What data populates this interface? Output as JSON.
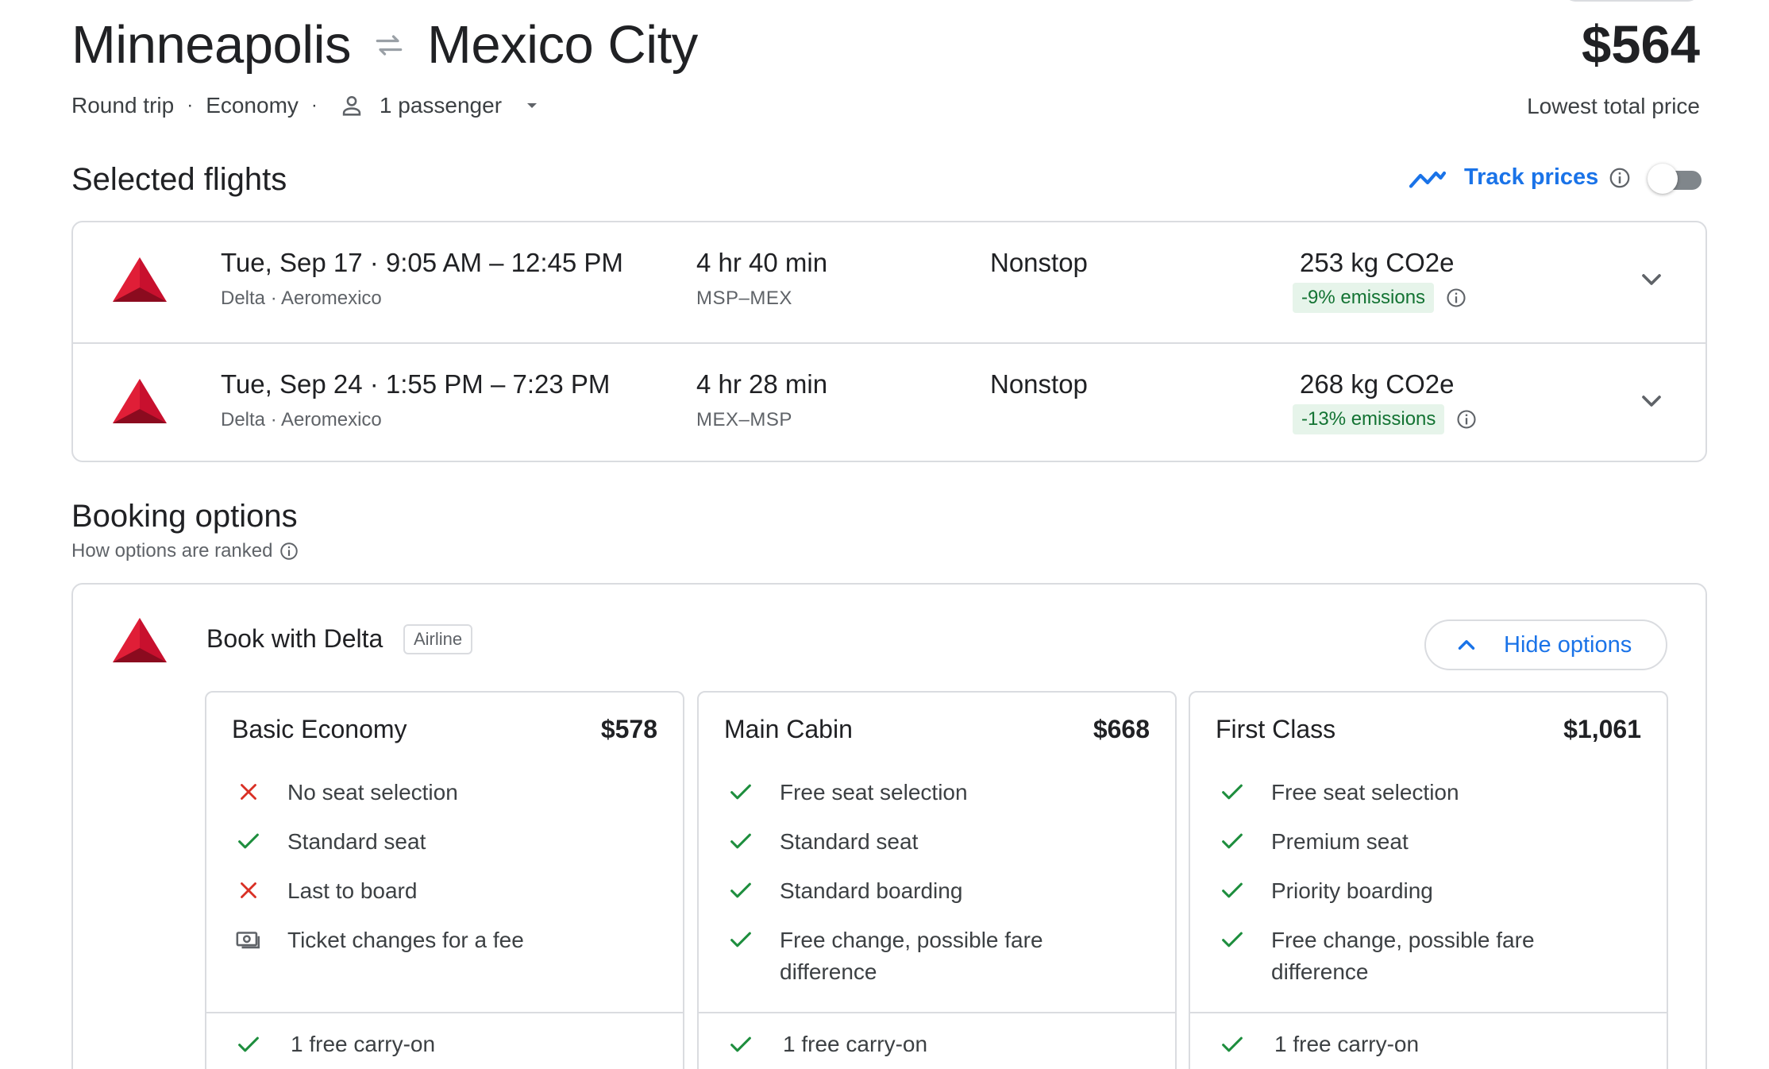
{
  "header": {
    "origin": "Minneapolis",
    "destination": "Mexico City",
    "trip_type": "Round trip",
    "cabin": "Economy",
    "passengers": "1 passenger",
    "price": "$564",
    "price_caption": "Lowest total price"
  },
  "selected_flights": {
    "title": "Selected flights",
    "track_label": "Track prices",
    "track_enabled": false,
    "flights": [
      {
        "times": "Tue, Sep 17  ·  9:05 AM – 12:45 PM",
        "airlines": "Delta · Aeromexico",
        "duration": "4 hr 40 min",
        "route": "MSP–MEX",
        "stops": "Nonstop",
        "co2": "253 kg CO2e",
        "emissions": "-9% emissions"
      },
      {
        "times": "Tue, Sep 24  ·  1:55 PM – 7:23 PM",
        "airlines": "Delta · Aeromexico",
        "duration": "4 hr 28 min",
        "route": "MEX–MSP",
        "stops": "Nonstop",
        "co2": "268 kg CO2e",
        "emissions": "-13% emissions"
      }
    ]
  },
  "booking": {
    "title": "Booking options",
    "subtitle": "How options are ranked",
    "provider": "Book with Delta",
    "provider_tag": "Airline",
    "hide_label": "Hide options",
    "fares": [
      {
        "name": "Basic Economy",
        "price": "$578",
        "features": [
          {
            "icon": "x-icon",
            "text": "No seat selection"
          },
          {
            "icon": "check-icon",
            "text": "Standard seat"
          },
          {
            "icon": "x-icon",
            "text": "Last to board"
          },
          {
            "icon": "money-icon",
            "text": "Ticket changes for a fee"
          }
        ],
        "carry": "1 free carry-on"
      },
      {
        "name": "Main Cabin",
        "price": "$668",
        "features": [
          {
            "icon": "check-icon",
            "text": "Free seat selection"
          },
          {
            "icon": "check-icon",
            "text": "Standard seat"
          },
          {
            "icon": "check-icon",
            "text": "Standard boarding"
          },
          {
            "icon": "check-icon",
            "text": "Free change, possible fare difference"
          }
        ],
        "carry": "1 free carry-on"
      },
      {
        "name": "First Class",
        "price": "$1,061",
        "features": [
          {
            "icon": "check-icon",
            "text": "Free seat selection"
          },
          {
            "icon": "check-icon",
            "text": "Premium seat"
          },
          {
            "icon": "check-icon",
            "text": "Priority boarding"
          },
          {
            "icon": "check-icon",
            "text": "Free change, possible fare difference"
          }
        ],
        "carry": "1 free carry-on"
      }
    ]
  },
  "colors": {
    "accent": "#1a73e8",
    "check": "#1e8e3e",
    "x": "#d93025",
    "delta": "#c8102e",
    "emissions_bg": "#e6f4ea",
    "emissions_text": "#137333"
  }
}
